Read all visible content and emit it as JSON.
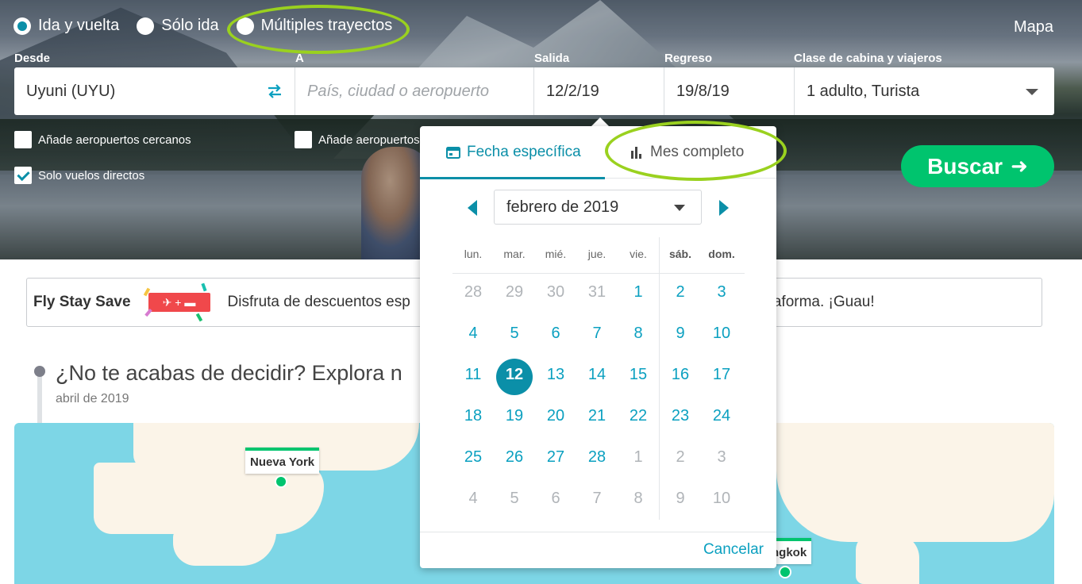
{
  "trip_type": {
    "options": [
      "Ida y vuelta",
      "Sólo ida",
      "Múltiples trayectos"
    ],
    "selected": "Ida y vuelta"
  },
  "map_link": "Mapa",
  "fields": {
    "from_label": "Desde",
    "from_value": "Uyuni (UYU)",
    "to_label": "A",
    "to_placeholder": "País, ciudad o aeropuerto",
    "depart_label": "Salida",
    "depart_value": "12/2/19",
    "return_label": "Regreso",
    "return_value": "19/8/19",
    "cabin_label": "Clase de cabina y viajeros",
    "cabin_value": "1 adulto, Turista"
  },
  "checkboxes": {
    "nearby_from": {
      "label": "Añade aeropuertos cercanos",
      "checked": false
    },
    "nearby_to": {
      "label": "Añade aeropuertos",
      "checked": false
    },
    "direct_only": {
      "label": "Solo vuelos directos",
      "checked": true
    }
  },
  "search_button": "Buscar",
  "promo": {
    "title": "Fly Stay Save",
    "text_left": "Disfruta de descuentos esp",
    "text_right": "ataforma. ¡Guau!"
  },
  "explore": {
    "title": "¿No te acabas de decidir? Explora n",
    "subtitle": "abril de 2019",
    "pins": [
      "Nueva York",
      "ngkok"
    ]
  },
  "calendar": {
    "tabs": [
      "Fecha específica",
      "Mes completo"
    ],
    "active_tab": "Fecha específica",
    "month": "febrero de 2019",
    "weekdays": [
      "lun.",
      "mar.",
      "mié.",
      "jue.",
      "vie.",
      "sáb.",
      "dom."
    ],
    "weeks": [
      [
        {
          "d": "28",
          "m": "other"
        },
        {
          "d": "29",
          "m": "other"
        },
        {
          "d": "30",
          "m": "other"
        },
        {
          "d": "31",
          "m": "other"
        },
        {
          "d": "1",
          "m": "cur"
        },
        {
          "d": "2",
          "m": "cur"
        },
        {
          "d": "3",
          "m": "cur"
        }
      ],
      [
        {
          "d": "4",
          "m": "cur"
        },
        {
          "d": "5",
          "m": "cur"
        },
        {
          "d": "6",
          "m": "cur"
        },
        {
          "d": "7",
          "m": "cur"
        },
        {
          "d": "8",
          "m": "cur"
        },
        {
          "d": "9",
          "m": "cur"
        },
        {
          "d": "10",
          "m": "cur"
        }
      ],
      [
        {
          "d": "11",
          "m": "cur"
        },
        {
          "d": "12",
          "m": "sel"
        },
        {
          "d": "13",
          "m": "cur"
        },
        {
          "d": "14",
          "m": "cur"
        },
        {
          "d": "15",
          "m": "cur"
        },
        {
          "d": "16",
          "m": "cur"
        },
        {
          "d": "17",
          "m": "cur"
        }
      ],
      [
        {
          "d": "18",
          "m": "cur"
        },
        {
          "d": "19",
          "m": "cur"
        },
        {
          "d": "20",
          "m": "cur"
        },
        {
          "d": "21",
          "m": "cur"
        },
        {
          "d": "22",
          "m": "cur"
        },
        {
          "d": "23",
          "m": "cur"
        },
        {
          "d": "24",
          "m": "cur"
        }
      ],
      [
        {
          "d": "25",
          "m": "cur"
        },
        {
          "d": "26",
          "m": "cur"
        },
        {
          "d": "27",
          "m": "cur"
        },
        {
          "d": "28",
          "m": "cur"
        },
        {
          "d": "1",
          "m": "other"
        },
        {
          "d": "2",
          "m": "other"
        },
        {
          "d": "3",
          "m": "other"
        }
      ],
      [
        {
          "d": "4",
          "m": "other"
        },
        {
          "d": "5",
          "m": "other"
        },
        {
          "d": "6",
          "m": "other"
        },
        {
          "d": "7",
          "m": "other"
        },
        {
          "d": "8",
          "m": "other"
        },
        {
          "d": "9",
          "m": "other"
        },
        {
          "d": "10",
          "m": "other"
        }
      ]
    ],
    "cancel": "Cancelar"
  },
  "colors": {
    "accent": "#0b8fa8",
    "search_button": "#00c46e",
    "annotation": "#9ad11f",
    "promo_badge": "#f0484b",
    "map_water": "#7dd6e6"
  }
}
